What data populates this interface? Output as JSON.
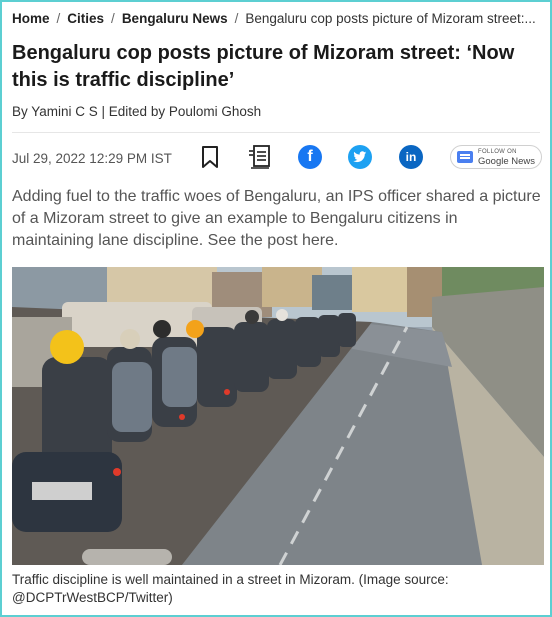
{
  "breadcrumb": {
    "items": [
      "Home",
      "Cities",
      "Bengaluru News"
    ],
    "current": "Bengaluru cop posts picture of Mizoram street:..."
  },
  "article": {
    "title": "Bengaluru cop posts picture of Mizoram street: ‘Now this is traffic discipline’",
    "byline": "By Yamini C S | Edited by Poulomi Ghosh",
    "date": "Jul 29, 2022 12:29 PM IST",
    "summary": "Adding fuel to the traffic woes of Bengaluru, an IPS officer shared a picture of a Mizoram street to give an example to Bengaluru citizens in maintaining lane discipline. See the post here.",
    "caption": "Traffic discipline is well maintained in a street in Mizoram. (Image source: @DCPTrWestBCP/Twitter)"
  },
  "share": {
    "facebook_glyph": "f",
    "linkedin_glyph": "in",
    "google_news_follow": "FOLLOW ON",
    "google_news_label": "Google News"
  },
  "icons": [
    "bookmark-icon",
    "article-icon",
    "facebook-icon",
    "twitter-icon",
    "linkedin-icon",
    "google-news-icon"
  ],
  "colors": {
    "frame": "#5ccfd2",
    "facebook": "#1877f2",
    "twitter": "#1da1f2",
    "linkedin": "#0a66c2",
    "summary_text": "#555555"
  }
}
